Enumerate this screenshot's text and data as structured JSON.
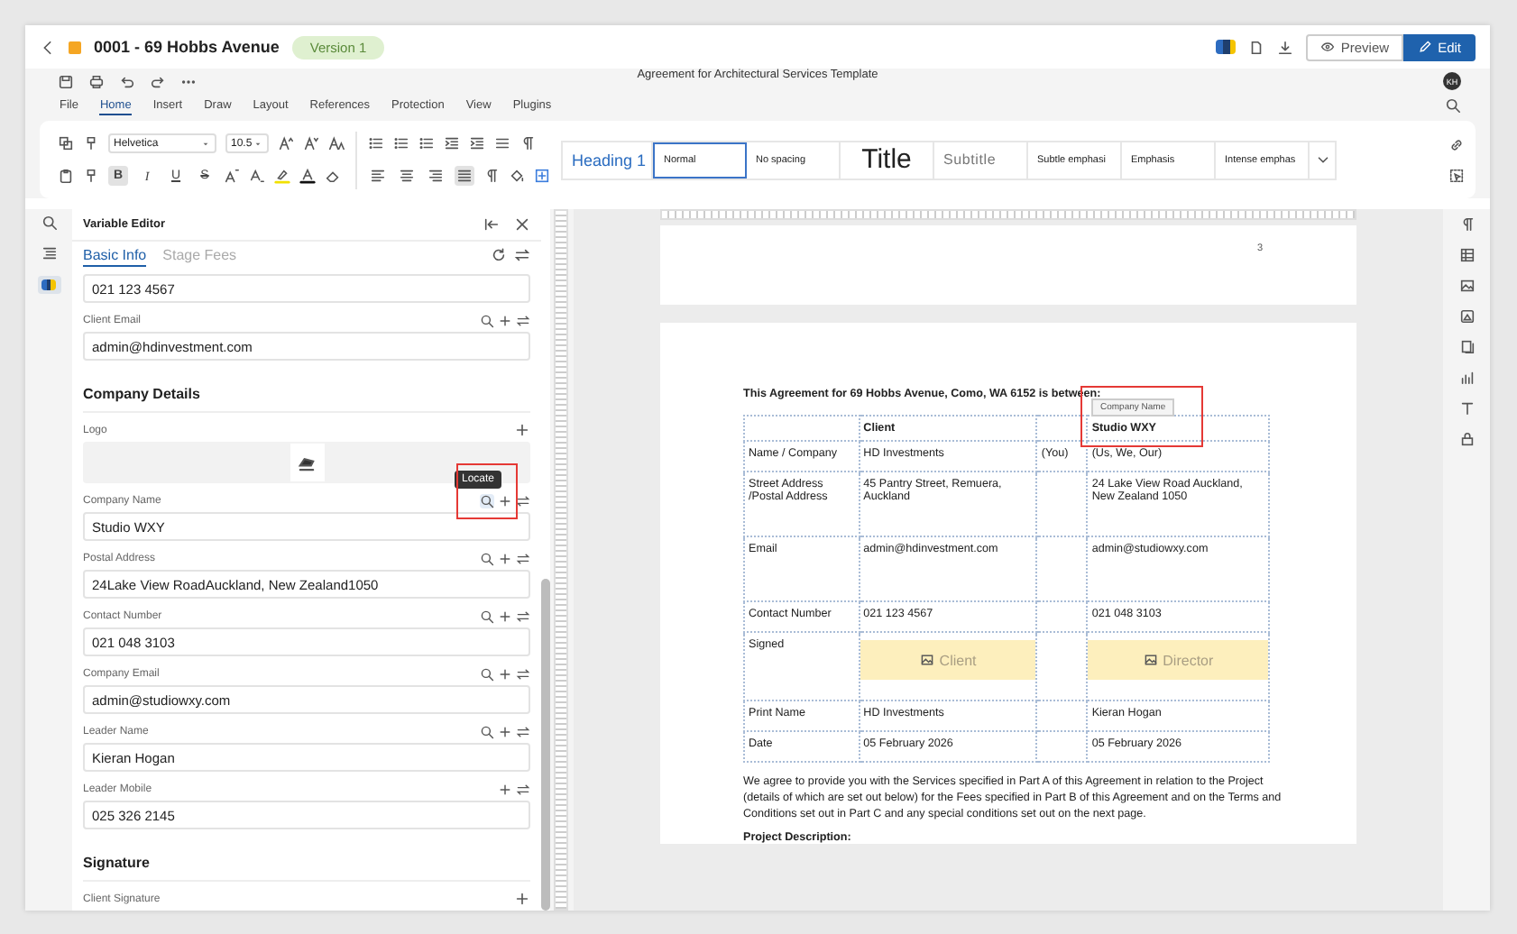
{
  "header": {
    "title": "0001 - 69 Hobbs Avenue",
    "version": "Version 1",
    "preview_label": "Preview",
    "edit_label": "Edit"
  },
  "document_title": "Agreement for Architectural Services Template",
  "avatar": "KH",
  "menu": [
    {
      "label": "File",
      "selected": false
    },
    {
      "label": "Home",
      "selected": true
    },
    {
      "label": "Insert",
      "selected": false
    },
    {
      "label": "Draw",
      "selected": false
    },
    {
      "label": "Layout",
      "selected": false
    },
    {
      "label": "References",
      "selected": false
    },
    {
      "label": "Protection",
      "selected": false
    },
    {
      "label": "View",
      "selected": false
    },
    {
      "label": "Plugins",
      "selected": false
    }
  ],
  "ribbon": {
    "font": "Helvetica",
    "size": "10.5",
    "format_buttons": [
      {
        "label": "B",
        "selected": true
      },
      {
        "label": "I",
        "selected": false
      },
      {
        "label": "U",
        "selected": false
      },
      {
        "label": "S",
        "selected": false
      }
    ],
    "alignment": [
      {
        "selected": false
      },
      {
        "selected": false
      },
      {
        "selected": false
      },
      {
        "selected": true
      }
    ],
    "styles": [
      {
        "label": "Heading 1",
        "kind": "heading",
        "selected": false
      },
      {
        "label": "Normal",
        "kind": "normal",
        "selected": true
      },
      {
        "label": "No spacing",
        "kind": "normal",
        "selected": false
      },
      {
        "label": "Title",
        "kind": "title",
        "selected": false
      },
      {
        "label": "Subtitle",
        "kind": "subtitle",
        "selected": false
      },
      {
        "label": "Subtle emphasi",
        "kind": "normal",
        "selected": false
      },
      {
        "label": "Emphasis",
        "kind": "normal",
        "selected": false
      },
      {
        "label": "Intense emphas",
        "kind": "normal",
        "selected": false
      }
    ]
  },
  "variable_editor": {
    "title": "Variable Editor",
    "tabs": [
      {
        "label": "Basic Info",
        "selected": true
      },
      {
        "label": "Stage Fees",
        "selected": false
      }
    ],
    "items": [
      {
        "kind": "field",
        "value": "021 123 4567"
      },
      {
        "kind": "field",
        "label": "Client Email",
        "value": "admin@hdinvestment.com",
        "searchable": true,
        "highlighted": false
      },
      {
        "kind": "section",
        "label": "Company Details"
      },
      {
        "kind": "image",
        "label": "Logo"
      },
      {
        "kind": "field",
        "label": "Company Name",
        "value": "Studio WXY",
        "searchable": true,
        "highlighted": true,
        "tooltip": "Locate"
      },
      {
        "kind": "field",
        "label": "Postal Address",
        "value": "24Lake View RoadAuckland, New Zealand1050",
        "searchable": true,
        "highlighted": false
      },
      {
        "kind": "field",
        "label": "Contact Number",
        "value": "021 048 3103",
        "searchable": true,
        "highlighted": false
      },
      {
        "kind": "field",
        "label": "Company Email",
        "value": "admin@studiowxy.com",
        "searchable": true,
        "highlighted": false
      },
      {
        "kind": "field",
        "label": "Leader Name",
        "value": "Kieran Hogan",
        "searchable": true,
        "highlighted": false
      },
      {
        "kind": "field",
        "label": "Leader Mobile",
        "value": "025 326 2145",
        "searchable": false,
        "highlighted": false
      },
      {
        "kind": "section",
        "label": "Signature"
      },
      {
        "kind": "image",
        "label": "Client Signature"
      }
    ]
  },
  "page_number": "3",
  "agreement": {
    "intro": "This Agreement for 69 Hobbs Avenue, Como, WA 6152 is between:",
    "variable_tag": "Company Name",
    "rows": [
      {
        "kind": "header",
        "highlighted": true,
        "cells": [
          "",
          "Client",
          "",
          "Studio WXY"
        ]
      },
      {
        "kind": "text",
        "cells": [
          "Name / Company",
          "HD Investments",
          "(You)",
          "(Us, We, Our)"
        ]
      },
      {
        "kind": "text",
        "cells": [
          "Street Address /Postal Address",
          "45 Pantry Street, Remuera, Auckland",
          "",
          "24 Lake View Road Auckland, New Zealand 1050"
        ]
      },
      {
        "kind": "text",
        "cells": [
          "Email",
          "admin@hdinvestment.com",
          "",
          "admin@studiowxy.com"
        ]
      },
      {
        "kind": "text",
        "cells": [
          "Contact Number",
          "021 123 4567",
          "",
          "021 048 3103"
        ]
      },
      {
        "kind": "signature",
        "cells": [
          "Signed",
          "Client",
          "",
          "Director"
        ]
      },
      {
        "kind": "text",
        "cells": [
          "Print Name",
          "HD Investments",
          "",
          "Kieran Hogan"
        ]
      },
      {
        "kind": "text",
        "cells": [
          "Date",
          "05 February 2026",
          "",
          "05 February 2026"
        ]
      }
    ],
    "paragraph": "We agree to provide you with the Services specified in Part A of this Agreement in relation to the Project (details of which are set out below) for the Fees specified in Part B of this Agreement and on the Terms and Conditions set out in Part C and any special conditions set out on the next page.",
    "heading": "Project Description:"
  }
}
